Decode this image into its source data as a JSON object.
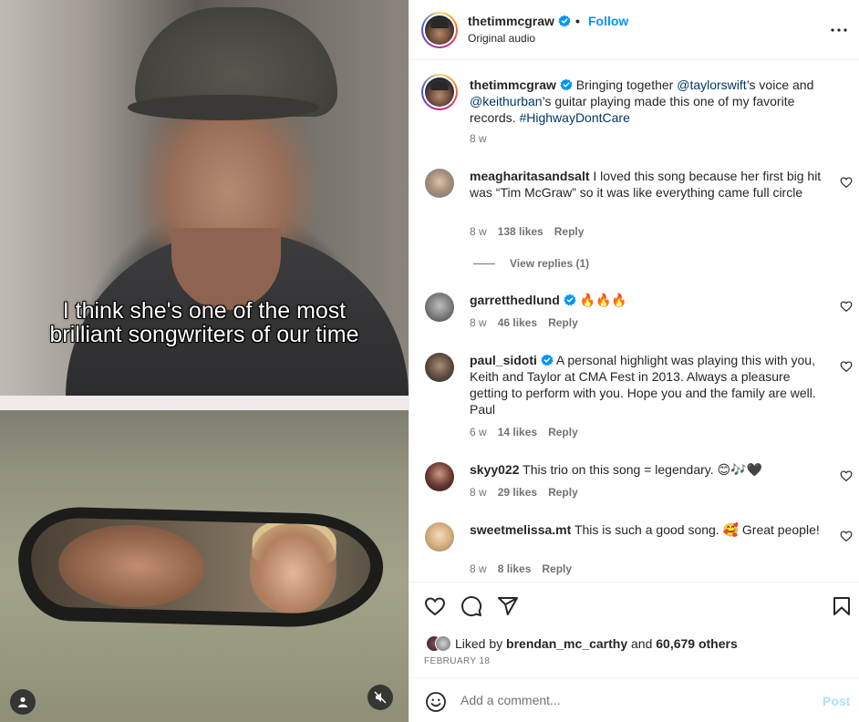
{
  "media": {
    "subtitle_line1": "I think she's one of the most",
    "subtitle_line2": "brilliant songwriters of our time",
    "user_tag_icon": "person-icon",
    "mute_icon": "speaker-muted-icon"
  },
  "post_header": {
    "username": "thetimmcgraw",
    "separator": "•",
    "follow_label": "Follow",
    "audio_label": "Original audio",
    "more_icon": "more-options-icon"
  },
  "caption": {
    "username": "thetimmcgraw",
    "text_1": "Bringing together ",
    "mention_1": "@taylorswift",
    "text_2": "’s voice and ",
    "mention_2": "@keithurban",
    "text_3": "’s guitar playing made this one of my favorite records. ",
    "hashtag": "#HighwayDontCare",
    "time": "8 w"
  },
  "comments": [
    {
      "username": "meagharitasandsalt",
      "verified": false,
      "text": "I loved this song because her first big hit was “Tim McGraw” so it was like everything came full circle",
      "time": "8 w",
      "likes": "138 likes",
      "reply": "Reply",
      "view_replies": "View replies (1)"
    },
    {
      "username": "garretthedlund",
      "verified": true,
      "text": "🔥🔥🔥",
      "time": "8 w",
      "likes": "46 likes",
      "reply": "Reply"
    },
    {
      "username": "paul_sidoti",
      "verified": true,
      "text": "A personal highlight was playing this with you, Keith and Taylor at CMA Fest in 2013. Always a pleasure getting to perform with you. Hope you and the family are well. Paul",
      "time": "6 w",
      "likes": "14 likes",
      "reply": "Reply"
    },
    {
      "username": "skyy022",
      "verified": false,
      "text": "This trio on this song = legendary. 😊🎶🖤",
      "time": "8 w",
      "likes": "29 likes",
      "reply": "Reply"
    },
    {
      "username": "sweetmelissa.mt",
      "verified": false,
      "text": "This is such a good song. 🥰 Great people!",
      "time": "8 w",
      "likes": "8 likes",
      "reply": "Reply"
    }
  ],
  "actions": {
    "like_icon": "heart-icon",
    "comment_icon": "comment-bubble-icon",
    "share_icon": "paper-plane-icon",
    "save_icon": "bookmark-icon",
    "liked_by_prefix": "Liked by",
    "liked_by_user": "brendan_mc_carthy",
    "liked_by_and": "and",
    "liked_by_others": "60,679 others",
    "date": "FEBRUARY 18"
  },
  "comment_box": {
    "emoji_icon": "emoji-smile-icon",
    "placeholder": "Add a comment...",
    "post_label": "Post"
  },
  "colors": {
    "accent": "#0095f6",
    "post_disabled": "#b2dffc",
    "secondary_text": "#737373",
    "mention": "#00376b"
  }
}
